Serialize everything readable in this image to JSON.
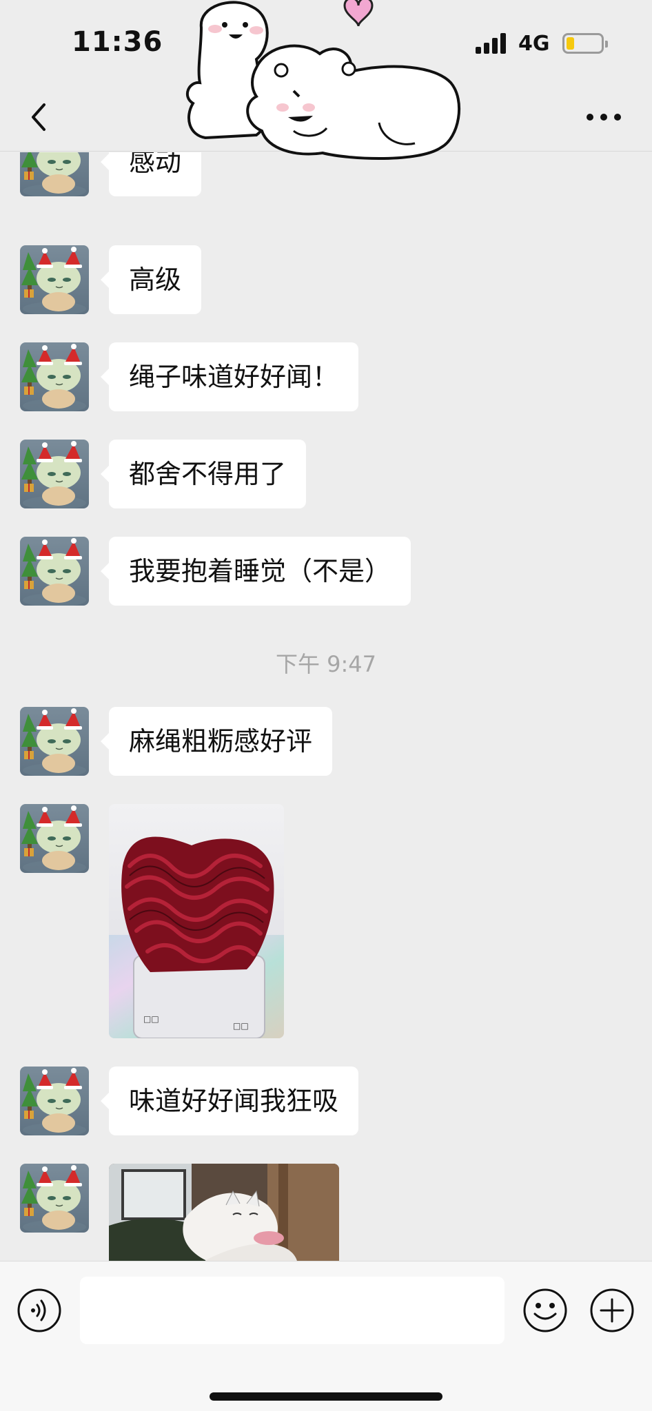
{
  "status_bar": {
    "time": "11:36",
    "network": "4G",
    "battery_level": 0.2
  },
  "chat": {
    "messages_before": [
      {
        "text": "感动"
      },
      {
        "text": "高级"
      },
      {
        "text": "绳子味道好好闻！"
      },
      {
        "text": "都舍不得用了"
      },
      {
        "text": "我要抱着睡觉（不是）"
      }
    ],
    "timestamp": "下午 9:47",
    "messages_after": [
      {
        "text": "麻绳粗粝感好评"
      },
      {
        "image": "red-rope-coil-photo"
      },
      {
        "text": "味道好好闻我狂吸"
      },
      {
        "image": "white-cat-photo"
      }
    ]
  },
  "input_bar": {
    "placeholder": ""
  },
  "icons": {
    "back": "chevron-left-icon",
    "more": "more-dots-icon",
    "voice": "voice-icon",
    "emoji": "emoji-icon",
    "plus": "plus-icon"
  },
  "colors": {
    "background": "#ededed",
    "bubble": "#ffffff",
    "timestamp": "#a6a6a6",
    "battery": "#f6c90e"
  }
}
